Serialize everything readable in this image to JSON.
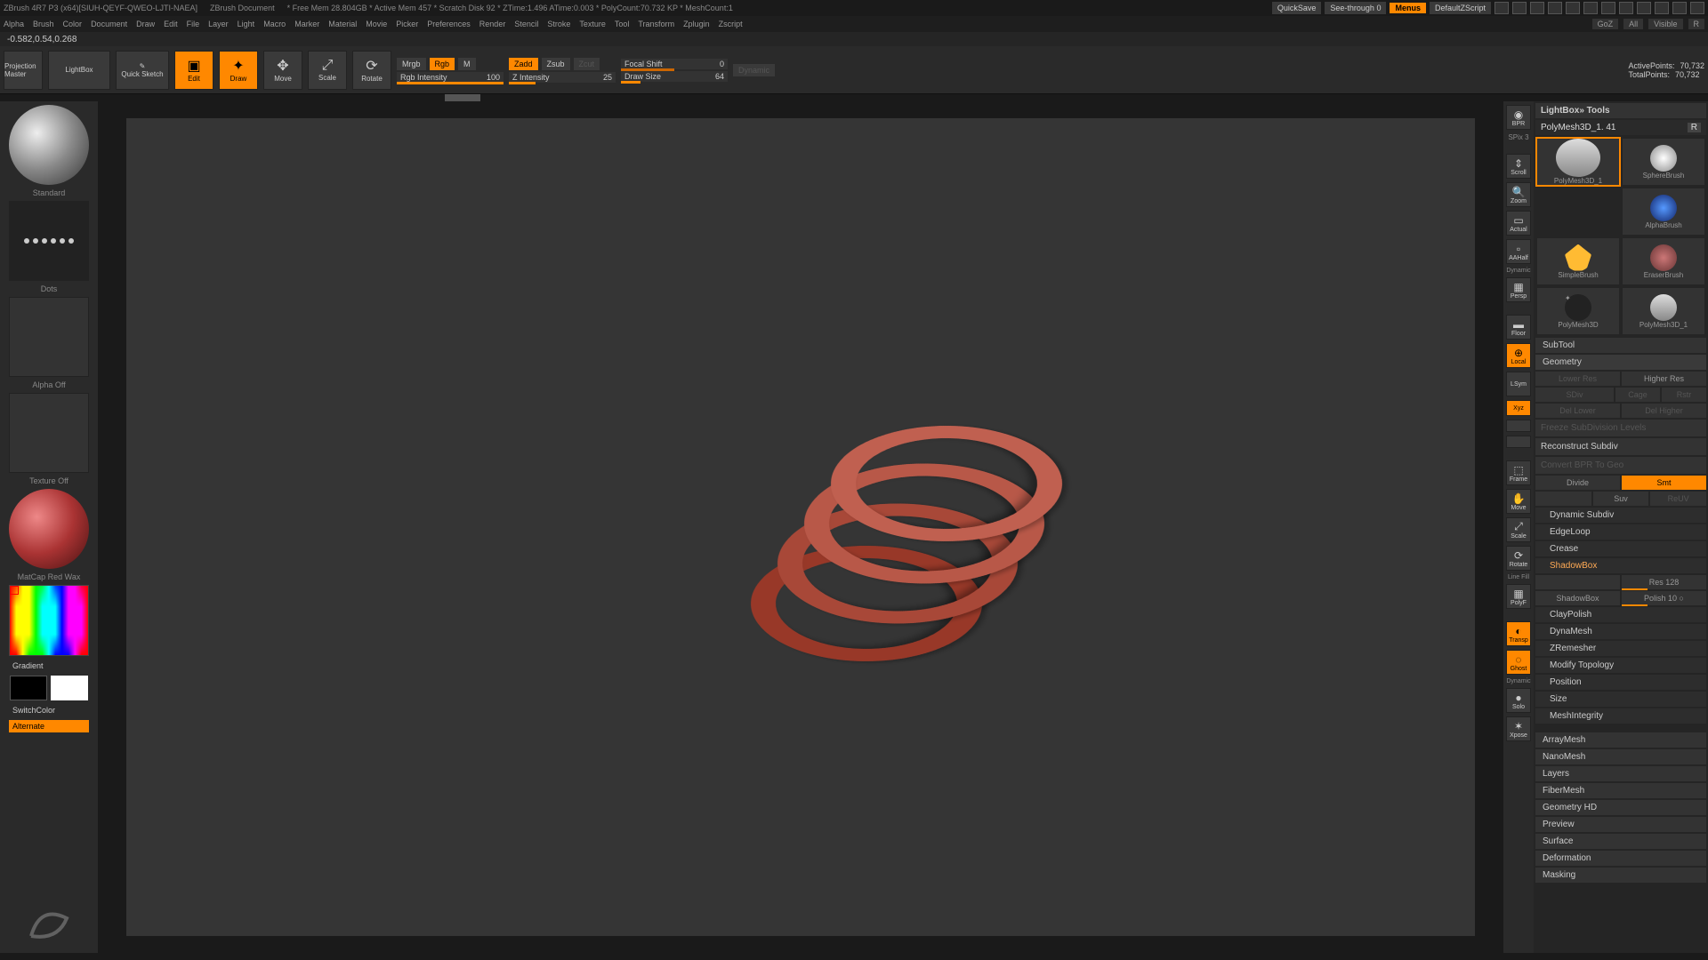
{
  "titlebar": {
    "app": "ZBrush 4R7 P3 (x64)[SIUH-QEYF-QWEO-LJTI-NAEA]",
    "doc": "ZBrush Document",
    "stats": "* Free Mem 28.804GB * Active Mem 457 * Scratch Disk 92 * ZTime:1.496 ATime:0.003 * PolyCount:70.732 KP * MeshCount:1",
    "quicksave": "QuickSave",
    "seethrough": "See-through 0",
    "menus": "Menus",
    "script": "DefaultZScript"
  },
  "menubar": {
    "items": [
      "Alpha",
      "Brush",
      "Color",
      "Document",
      "Draw",
      "Edit",
      "File",
      "Layer",
      "Light",
      "Macro",
      "Marker",
      "Material",
      "Movie",
      "Picker",
      "Preferences",
      "Render",
      "Stencil",
      "Stroke",
      "Texture",
      "Tool",
      "Transform",
      "Zplugin",
      "Zscript"
    ],
    "right": {
      "goz": "GoZ",
      "all": "All",
      "visible": "Visible",
      "r": "R"
    }
  },
  "coords": "-0.582,0.54,0.268",
  "shelf": {
    "projection": "Projection Master",
    "lightbox": "LightBox",
    "quicksketch": "Quick Sketch",
    "edit": "Edit",
    "draw": "Draw",
    "move": "Move",
    "scale": "Scale",
    "rotate": "Rotate",
    "mrgb": "Mrgb",
    "rgb": "Rgb",
    "m": "M",
    "rgbint_label": "Rgb Intensity",
    "rgbint_val": "100",
    "zadd": "Zadd",
    "zsub": "Zsub",
    "zcut": "Zcut",
    "zint_label": "Z Intensity",
    "zint_val": "25",
    "focal_label": "Focal Shift",
    "focal_val": "0",
    "drawsize_label": "Draw Size",
    "drawsize_val": "64",
    "dynamic": "Dynamic",
    "active_pts_label": "ActivePoints:",
    "active_pts_val": "70,732",
    "total_pts_label": "TotalPoints:",
    "total_pts_val": "70,732"
  },
  "left": {
    "brush": "Standard",
    "stroke": "Dots",
    "alpha": "Alpha Off",
    "texture": "Texture Off",
    "material": "MatCap Red Wax",
    "gradient": "Gradient",
    "switchcolor": "SwitchColor",
    "alternate": "Alternate"
  },
  "righticons": {
    "bpr": "BPR",
    "spix": "SPix 3",
    "scroll": "Scroll",
    "zoom": "Zoom",
    "actual": "Actual",
    "aahalf": "AAHalf",
    "persp": "Persp",
    "floor": "Floor",
    "local": "Local",
    "lsym": "LSym",
    "xyz": "Xyz",
    "frame": "Frame",
    "move": "Move",
    "scale": "Scale",
    "rotate": "Rotate",
    "polyf": "PolyF",
    "transp": "Transp",
    "ghost": "Ghost",
    "solo": "Solo",
    "xpose": "Xpose",
    "linefill": "Line Fill",
    "dynamic": "Dynamic"
  },
  "rp": {
    "header": "LightBox» Tools",
    "toolname": "PolyMesh3D_1. 41",
    "tools": [
      {
        "name": "PolyMesh3D_1",
        "color": "#ddd"
      },
      {
        "name": "SphereBrush",
        "color": "#ccc"
      },
      {
        "name": "AlphaBrush",
        "color": "#359"
      },
      {
        "name": "SimpleBrush",
        "color": "#fb3"
      },
      {
        "name": "EraserBrush",
        "color": "#a55"
      },
      {
        "name": "PolyMesh3D",
        "color": "#333"
      },
      {
        "name": "PolyMesh3D_1",
        "color": "#ddd"
      }
    ],
    "subtool": "SubTool",
    "geometry": "Geometry",
    "lowerres": "Lower Res",
    "higherres": "Higher Res",
    "sdiv": "SDiv",
    "cage": "Cage",
    "rstr": "Rstr",
    "dellower": "Del Lower",
    "delhigher": "Del Higher",
    "freeze": "Freeze SubDivision Levels",
    "reconstruct": "Reconstruct Subdiv",
    "convert": "Convert BPR To Geo",
    "divide": "Divide",
    "smt": "Smt",
    "suv": "Suv",
    "resv": "ReUV",
    "dynsub": "Dynamic Subdiv",
    "edgeloop": "EdgeLoop",
    "crease": "Crease",
    "shadowbox": "ShadowBox",
    "sb_btn": "ShadowBox",
    "res_label": "Res",
    "res_val": "128",
    "polish_label": "Polish",
    "polish_val": "10",
    "claypolish": "ClayPolish",
    "dynamesh": "DynaMesh",
    "zremesher": "ZRemesher",
    "modtopo": "Modify Topology",
    "position": "Position",
    "size": "Size",
    "meshint": "MeshIntegrity",
    "arraymesh": "ArrayMesh",
    "nanomesh": "NanoMesh",
    "layers": "Layers",
    "fibermesh": "FiberMesh",
    "geomhd": "Geometry HD",
    "preview": "Preview",
    "surface": "Surface",
    "deformation": "Deformation",
    "masking": "Masking"
  }
}
